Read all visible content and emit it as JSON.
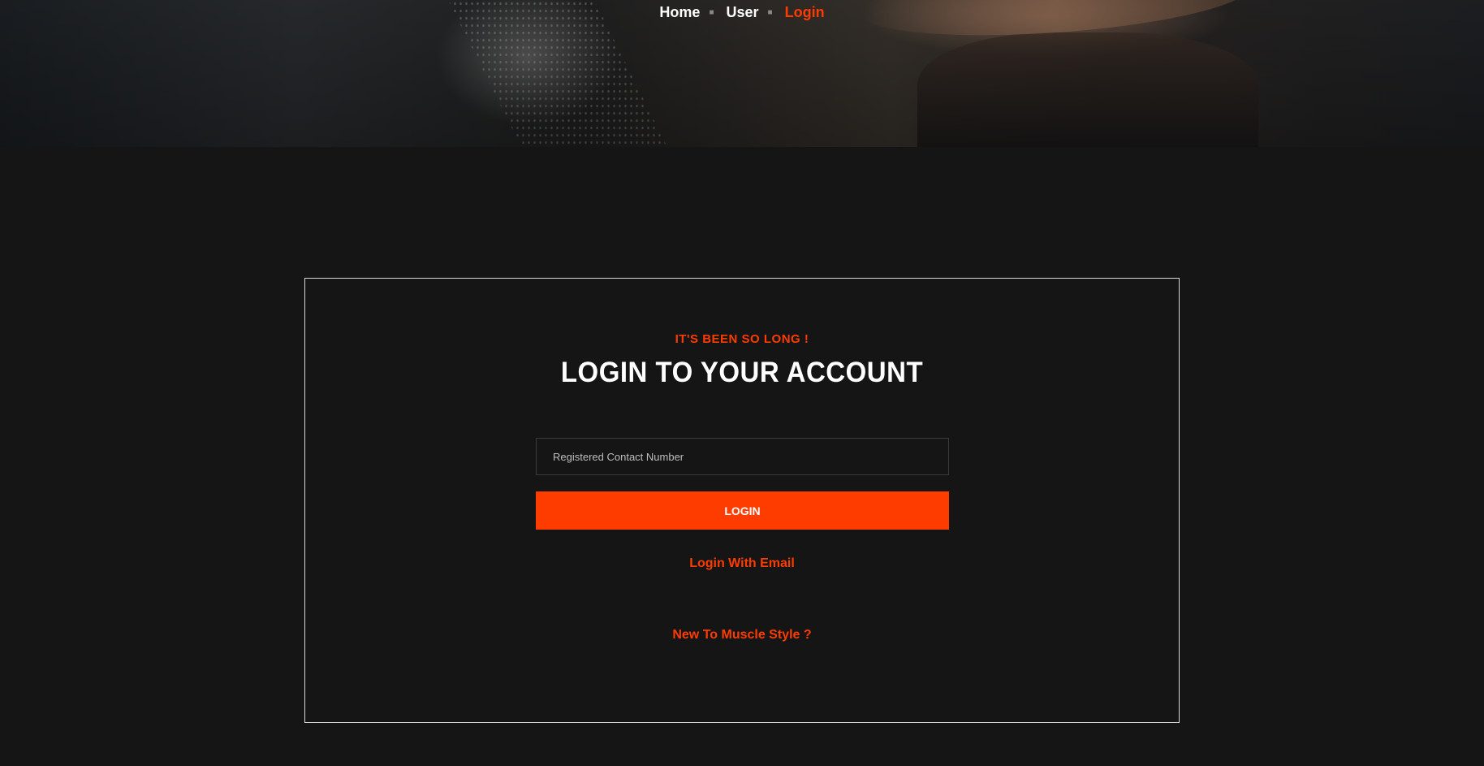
{
  "colors": {
    "accent": "#ff3c00",
    "background": "#151515",
    "text": "#ffffff"
  },
  "breadcrumb": {
    "items": [
      {
        "label": "Home",
        "active": false
      },
      {
        "label": "User",
        "active": false
      },
      {
        "label": "Login",
        "active": true
      }
    ],
    "separator_icon": "chevron-right-icon"
  },
  "login": {
    "eyebrow": "IT'S BEEN SO LONG !",
    "title": "LOGIN TO YOUR ACCOUNT",
    "contact_field": {
      "value": "",
      "placeholder": "Registered Contact Number"
    },
    "login_button": "LOGIN",
    "email_link": "Login With Email",
    "signup_link": "New To Muscle Style ?"
  }
}
